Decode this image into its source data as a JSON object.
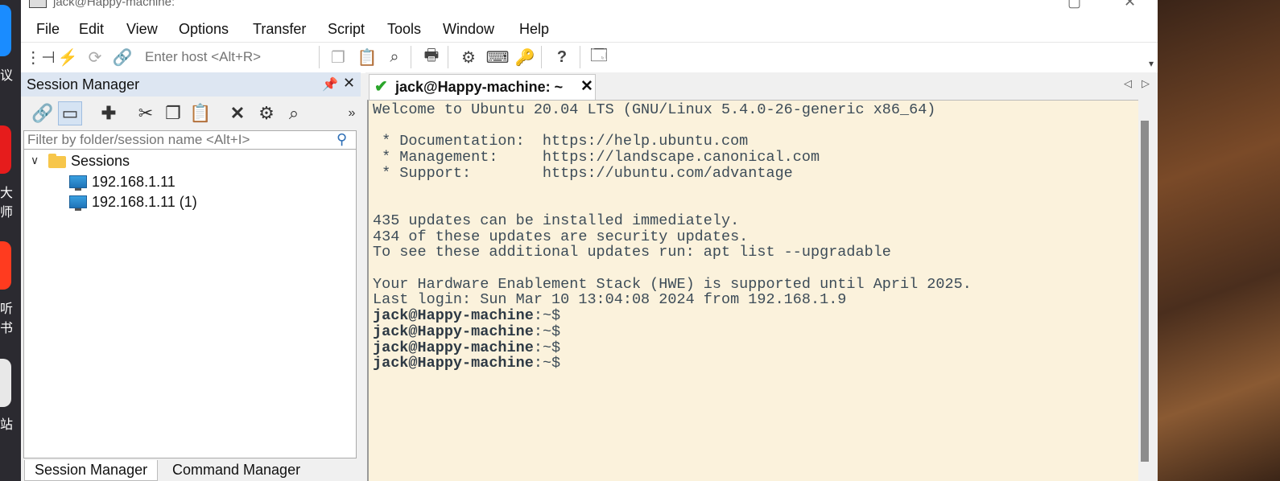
{
  "window": {
    "title": "jack@Happy-machine:"
  },
  "menu": [
    "File",
    "Edit",
    "View",
    "Options",
    "Transfer",
    "Script",
    "Tools",
    "Window",
    "Help"
  ],
  "toolbar": {
    "host_placeholder": "Enter host <Alt+R>"
  },
  "session_manager": {
    "title": "Session Manager",
    "filter_placeholder": "Filter by folder/session name <Alt+I>",
    "folder": "Sessions",
    "sessions": [
      "192.168.1.11",
      "192.168.1.11 (1)"
    ],
    "bottom_tabs": [
      "Session Manager",
      "Command Manager"
    ]
  },
  "terminal": {
    "tab_label": "jack@Happy-machine: ~",
    "lines": [
      "Welcome to Ubuntu 20.04 LTS (GNU/Linux 5.4.0-26-generic x86_64)",
      "",
      " * Documentation:  https://help.ubuntu.com",
      " * Management:     https://landscape.canonical.com",
      " * Support:        https://ubuntu.com/advantage",
      "",
      "",
      "435 updates can be installed immediately.",
      "434 of these updates are security updates.",
      "To see these additional updates run: apt list --upgradable",
      "",
      "Your Hardware Enablement Stack (HWE) is supported until April 2025.",
      "Last login: Sun Mar 10 13:04:08 2024 from 192.168.1.9"
    ],
    "prompt_user": "jack@Happy-machine",
    "prompt_suffix": ":~$",
    "prompt_count": 4
  },
  "desktop": {
    "labels": [
      "议",
      "大师",
      "听书",
      "站"
    ]
  },
  "colors": {
    "terminal_bg": "#fbf2dc",
    "terminal_fg": "#3d4c58",
    "panel_header": "#dde6f2"
  }
}
